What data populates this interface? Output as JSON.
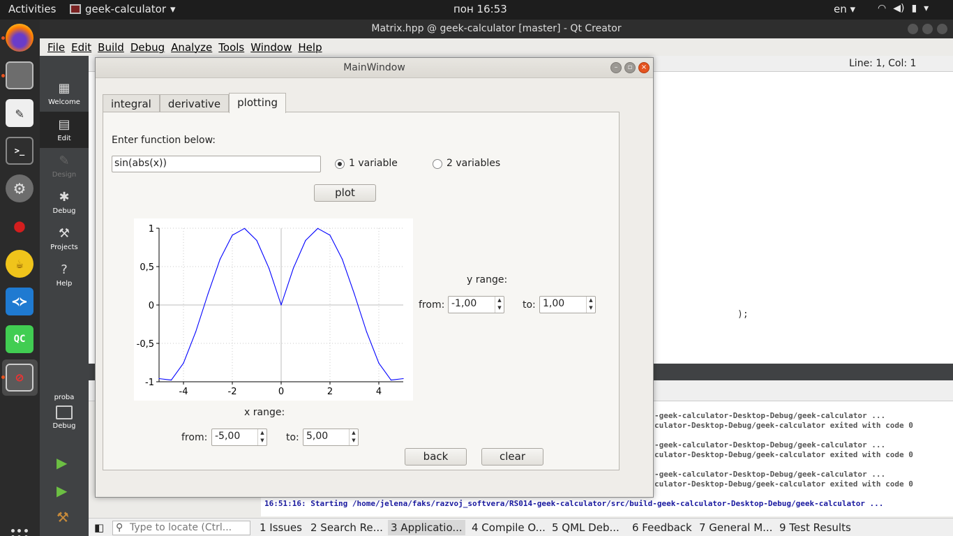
{
  "topbar": {
    "activities": "Activities",
    "app": "geek-calculator",
    "clock": "пон 16:53",
    "lang": "en"
  },
  "dock": {
    "qc_label": "QC"
  },
  "qtcreator": {
    "title": "Matrix.hpp @ geek-calculator [master] - Qt Creator",
    "menu": [
      "File",
      "Edit",
      "Build",
      "Debug",
      "Analyze",
      "Tools",
      "Window",
      "Help"
    ],
    "modes": [
      "Welcome",
      "Edit",
      "Design",
      "Debug",
      "Projects",
      "Help"
    ],
    "kit": {
      "project": "proba",
      "config": "Debug"
    },
    "position": "Line: 1, Col: 1",
    "editor_fragment": ");",
    "output_lines": [
      "-geek-calculator-Desktop-Debug/geek-calculator ...",
      "culator-Desktop-Debug/geek-calculator exited with code 0",
      "-geek-calculator-Desktop-Debug/geek-calculator ...",
      "culator-Desktop-Debug/geek-calculator exited with code 0",
      "-geek-calculator-Desktop-Debug/geek-calculator ...",
      "culator-Desktop-Debug/geek-calculator exited with code 0",
      "16:51:16: Starting /home/jelena/faks/razvoj_softvera/RS014-geek-calculator/src/build-geek-calculator-Desktop-Debug/geek-calculator ..."
    ],
    "locate_placeholder": "Type to locate (Ctrl...",
    "panes": [
      "1  Issues",
      "2  Search Re...",
      "3  Applicatio...",
      "4  Compile O...",
      "5  QML Deb...",
      "6  Feedback",
      "7  General M...",
      "9  Test Results"
    ]
  },
  "dialog": {
    "title": "MainWindow",
    "tabs": [
      "integral",
      "derivative",
      "plotting"
    ],
    "prompt": "Enter function below:",
    "function": "sin(abs(x))",
    "radio_1": "1 variable",
    "radio_2": "2 variables",
    "plot_button": "plot",
    "y_range_label": "y range:",
    "x_range_label": "x range:",
    "from_label": "from:",
    "to_label": "to:",
    "y_from": "-1,00",
    "y_to": "1,00",
    "x_from": "-5,00",
    "x_to": "5,00",
    "back_button": "back",
    "clear_button": "clear"
  },
  "chart_data": {
    "type": "line",
    "function": "sin(abs(x))",
    "xlim": [
      -5,
      5
    ],
    "ylim": [
      -1,
      1
    ],
    "x_ticks": [
      "-4",
      "-2",
      "0",
      "2",
      "4"
    ],
    "y_ticks": [
      "1",
      "0,5",
      "0",
      "-0,5",
      "-1"
    ],
    "x_tick_values": [
      -4,
      -2,
      0,
      2,
      4
    ],
    "y_tick_values": [
      1,
      0.5,
      0,
      -0.5,
      -1
    ],
    "grid": true,
    "line_color": "#0000ff",
    "series": [
      {
        "x": [
          -5,
          -4.5,
          -4,
          -3.5,
          -3,
          -2.5,
          -2,
          -1.5,
          -1,
          -0.5,
          0,
          0.5,
          1,
          1.5,
          2,
          2.5,
          3,
          3.5,
          4,
          4.5,
          5
        ],
        "y": [
          -0.959,
          -0.978,
          -0.757,
          -0.351,
          0.141,
          0.598,
          0.909,
          0.997,
          0.841,
          0.479,
          0,
          0.479,
          0.841,
          0.997,
          0.909,
          0.598,
          0.141,
          -0.351,
          -0.757,
          -0.978,
          -0.959
        ]
      }
    ]
  }
}
